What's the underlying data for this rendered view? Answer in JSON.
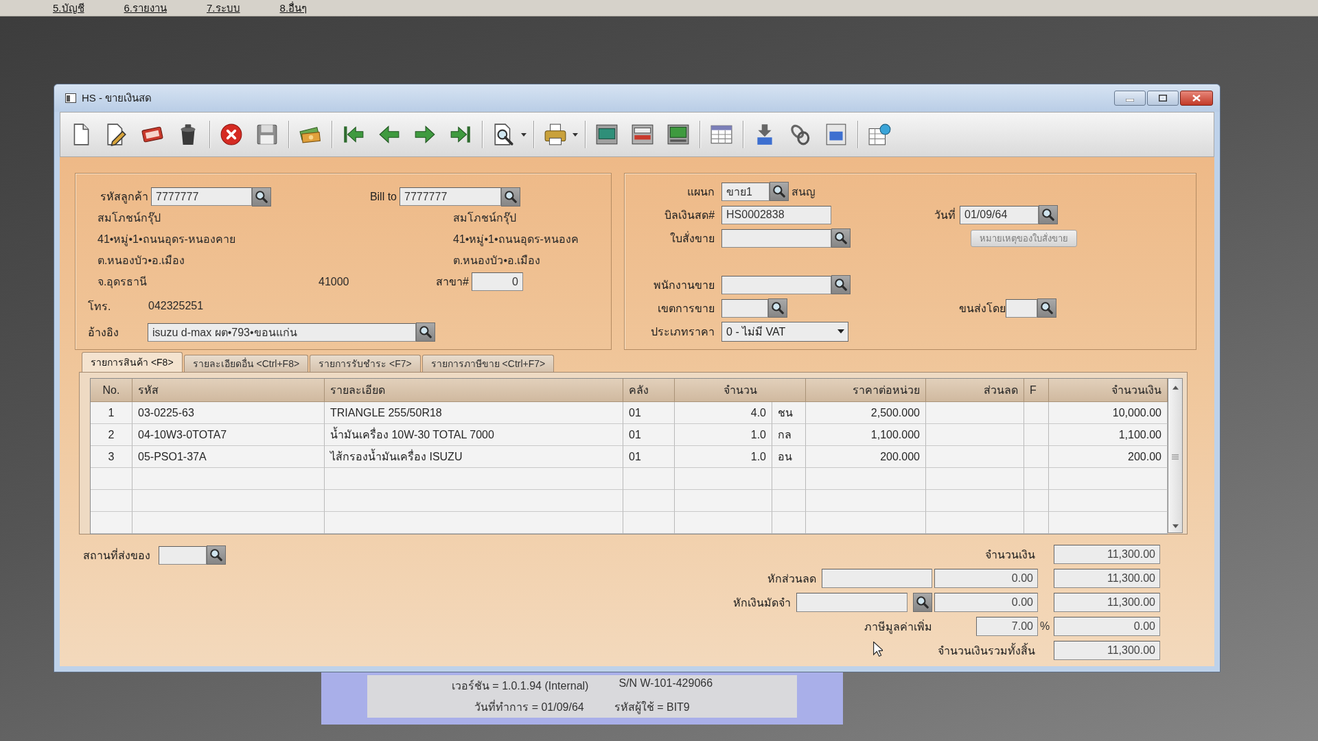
{
  "menu_bar": {
    "items": [
      {
        "label": "5.บัญชี"
      },
      {
        "label": "6.รายงาน"
      },
      {
        "label": "7.ระบบ"
      },
      {
        "label": "8.อื่นๆ"
      }
    ]
  },
  "window": {
    "title": "HS - ขายเงินสด"
  },
  "customer": {
    "code_label": "รหัสลูกค้า",
    "code": "7777777",
    "bill_to_label": "Bill to",
    "bill_to": "7777777",
    "name": "สมโภชน์กรุ๊ป",
    "address_1": "41•หมู่•1•ถนนอุดร-หนองคาย",
    "address_2": "ต.หนองบัว•อ.เมือง",
    "province": "จ.อุดรธานี",
    "postcode": "41000",
    "bill_to_name": "สมโภชน์กรุ๊ป",
    "bill_to_address_1": "41•หมู่•1•ถนนอุดร-หนองค",
    "bill_to_address_2": "ต.หนองบัว•อ.เมือง",
    "branch_label": "สาขา#",
    "branch": "0",
    "phone_label": "โทร.",
    "phone": "042325251",
    "reference_label": "อ้างอิง",
    "reference": "isuzu d-max ผต•793•ขอนแก่น"
  },
  "document": {
    "department_label": "แผนก",
    "department": "ขาย1",
    "department_name": "สนญ",
    "bill_no_label": "บิลเงินสด#",
    "bill_no": "HS0002838",
    "date_label": "วันที่",
    "date": "01/09/64",
    "sales_order_label": "ใบสั่งขาย",
    "sales_order_note_button": {
      "label": "หมายเหตุของใบสั่งขาย",
      "disabled": true
    },
    "salesperson_label": "พนักงานขาย",
    "sales_area_label": "เขตการขาย",
    "shipping_by_label": "ขนส่งโดย",
    "price_type_label": "ประเภทราคา",
    "price_type": "0 - ไม่มี VAT"
  },
  "tabs": [
    {
      "label": "รายการสินค้า <F8>",
      "selected": true
    },
    {
      "label": "รายละเอียดอื่น <Ctrl+F8>",
      "selected": false
    },
    {
      "label": "รายการรับชำระ <F7>",
      "selected": false
    },
    {
      "label": "รายการภาษีขาย <Ctrl+F7>",
      "selected": false
    }
  ],
  "table": {
    "columns": [
      "No.",
      "รหัส",
      "รายละเอียด",
      "คลัง",
      "จำนวน",
      "ราคาต่อหน่วย",
      "ส่วนลด",
      "F",
      "จำนวนเงิน"
    ],
    "rows": [
      {
        "no": "1",
        "code": "03-0225-63",
        "description": "TRIANGLE 255/50R18",
        "warehouse": "01",
        "quantity": "4.0",
        "unit": "ชน",
        "unit_price": "2,500.000",
        "amount": "10,000.00"
      },
      {
        "no": "2",
        "code": "04-10W3-0TOTA7",
        "description": "น้ำมันเครื่อง 10W-30 TOTAL 7000",
        "warehouse": "01",
        "quantity": "1.0",
        "unit": "กล",
        "unit_price": "1,100.000",
        "amount": "1,100.00"
      },
      {
        "no": "3",
        "code": "05-PSO1-37A",
        "description": "ไส้กรองน้ำมันเครื่อง ISUZU",
        "warehouse": "01",
        "quantity": "1.0",
        "unit": "อน",
        "unit_price": "200.000",
        "amount": "200.00"
      }
    ]
  },
  "delivery": {
    "label": "สถานที่ส่งของ"
  },
  "totals": {
    "subtotal_label": "จำนวนเงิน",
    "subtotal": "11,300.00",
    "discount_label": "หักส่วนลด",
    "discount": "0.00",
    "after_discount": "11,300.00",
    "deposit_label": "หักเงินมัดจำ",
    "deposit": "0.00",
    "after_deposit": "11,300.00",
    "vat_label": "ภาษีมูลค่าเพิ่ม",
    "vat_rate": "7.00",
    "vat_percent_sign": "%",
    "vat": "0.00",
    "grand_total_label": "จำนวนเงินรวมทั้งสิ้น",
    "grand_total": "11,300.00"
  },
  "status_panel": {
    "version": "เวอร์ชัน = 1.0.1.94 (Internal)",
    "serial": "S/N W-101-429066",
    "work_date": "วันที่ทำการ = 01/09/64",
    "user": "รหัสผู้ใช้ = BIT9"
  }
}
